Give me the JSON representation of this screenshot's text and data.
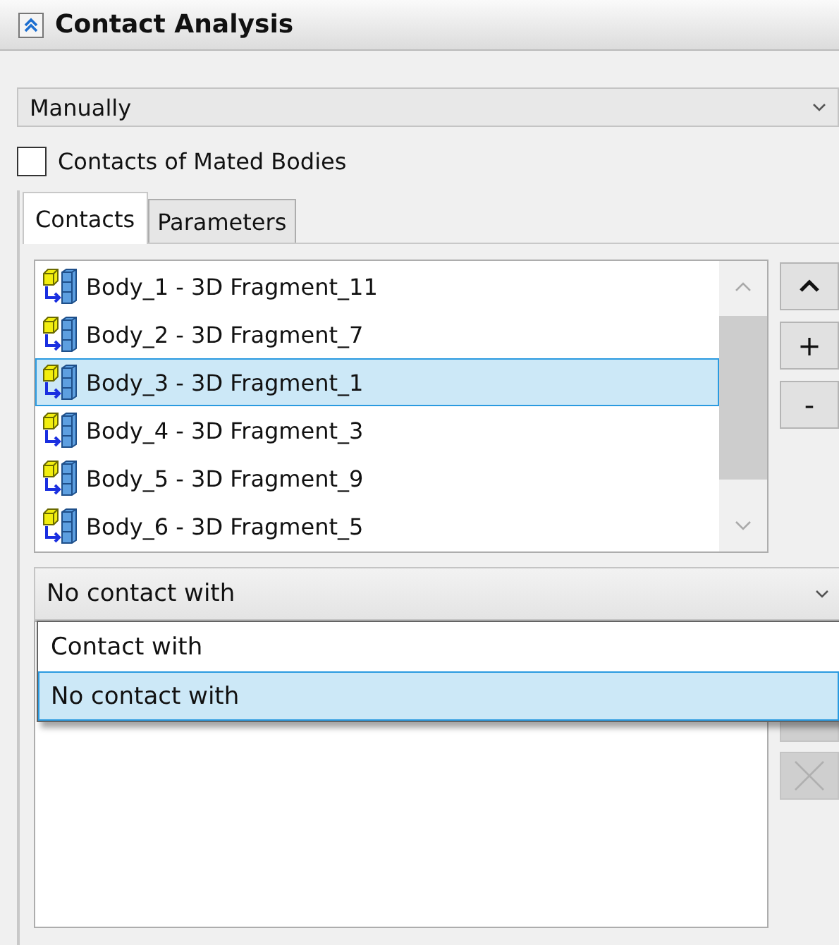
{
  "panel": {
    "title": "Contact Analysis"
  },
  "mode_select": {
    "value": "Manually"
  },
  "mated_bodies": {
    "label": "Contacts of Mated Bodies",
    "checked": false
  },
  "tabs": [
    {
      "label": "Contacts",
      "selected": true
    },
    {
      "label": "Parameters",
      "selected": false
    }
  ],
  "bodies": [
    {
      "label": "Body_1 - 3D Fragment_11",
      "selected": false
    },
    {
      "label": "Body_2 - 3D Fragment_7",
      "selected": false
    },
    {
      "label": "Body_3 - 3D Fragment_1",
      "selected": true
    },
    {
      "label": "Body_4 - 3D Fragment_3",
      "selected": false
    },
    {
      "label": "Body_5 - 3D Fragment_9",
      "selected": false
    },
    {
      "label": "Body_6 - 3D Fragment_5",
      "selected": false
    }
  ],
  "side_buttons": [
    {
      "kind": "up"
    },
    {
      "kind": "text",
      "label": "+"
    },
    {
      "kind": "text",
      "label": "-"
    }
  ],
  "contact_select": {
    "value": "No contact with",
    "options": [
      {
        "label": "Contact with",
        "selected": false
      },
      {
        "label": "No contact with",
        "selected": true
      }
    ]
  },
  "lower_buttons": [
    {
      "kind": "blank",
      "disabled": true
    },
    {
      "kind": "delete",
      "disabled": true
    }
  ]
}
